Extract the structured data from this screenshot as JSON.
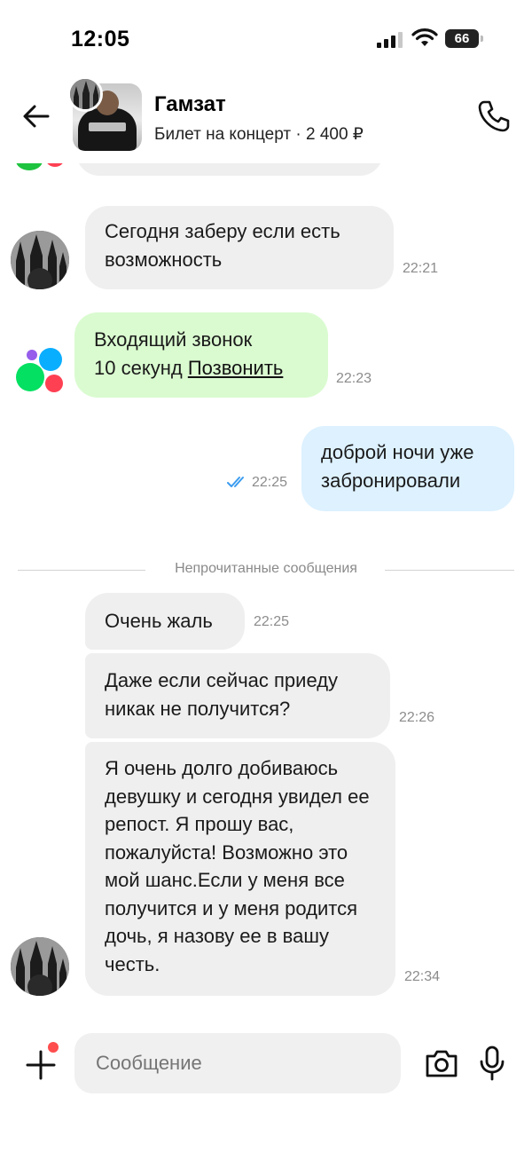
{
  "status_bar": {
    "time": "12:05",
    "battery": "66"
  },
  "header": {
    "name": "Гамзат",
    "subtitle": "Билет на концерт · 2 400 ₽"
  },
  "messages": [
    {
      "id": "m1",
      "direction": "in",
      "text": "Сегодня заберу если есть возможность",
      "time": "22:21"
    },
    {
      "id": "m2",
      "direction": "system-call",
      "text": "Входящий звонок",
      "duration": "10 секунд",
      "action": "Позвонить",
      "time": "22:23"
    },
    {
      "id": "m3",
      "direction": "out",
      "text": "доброй ночи уже забронировали",
      "time": "22:25",
      "read": true
    },
    {
      "id": "m4",
      "direction": "in",
      "text": "Очень жаль",
      "time": "22:25"
    },
    {
      "id": "m5",
      "direction": "in",
      "text": "Даже если сейчас приеду никак не получится?",
      "time": "22:26"
    },
    {
      "id": "m6",
      "direction": "in",
      "text": "Я очень долго добиваюсь девушку и сегодня увидел ее репост. Я прошу вас, пожалуйста! Возможно это мой шанс.Если у меня все получится и у меня родится дочь, я назову ее в вашу честь.",
      "time": "22:34"
    }
  ],
  "unread_divider": "Непрочитанные сообщения",
  "composer": {
    "placeholder": "Сообщение"
  },
  "colors": {
    "incoming_bubble": "#efefef",
    "call_bubble": "#dafbd0",
    "outgoing_bubble": "#ddf1ff",
    "read_checks": "#3b9cf0",
    "notification_dot": "#ff4d4d"
  },
  "icons": [
    "back-arrow-icon",
    "phone-icon",
    "double-check-icon",
    "plus-icon",
    "camera-icon",
    "microphone-icon"
  ]
}
